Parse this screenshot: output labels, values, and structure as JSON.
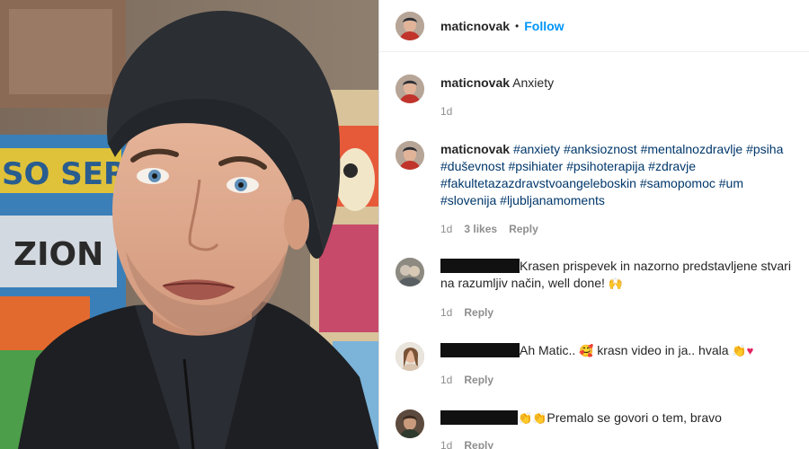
{
  "post": {
    "username": "maticnovak",
    "follow_label": "Follow",
    "separator": "•"
  },
  "caption": {
    "username": "maticnovak",
    "text": "Anxiety",
    "time": "1d"
  },
  "hashtags_comment": {
    "username": "maticnovak",
    "tags": [
      "#anxiety",
      "#anksioznost",
      "#mentalnozdravlje",
      "#psiha",
      "#duševnost",
      "#psihiater",
      "#psihoterapija",
      "#zdravje",
      "#fakultetazazdravstvoangeleboskin",
      "#samopomoc",
      "#um",
      "#slovenija",
      "#ljubljanamoments"
    ],
    "time": "1d",
    "likes": "3 likes",
    "reply": "Reply"
  },
  "comments": [
    {
      "text": "Krasen prispevek in nazorno predstavljene stvari na razumljiv način, well done! ",
      "emoji": "🙌",
      "time": "1d",
      "reply": "Reply"
    },
    {
      "text_before": "Ah Matic.. ",
      "emoji1": "🥰",
      "text_after": " krasn video in ja.. hvala ",
      "emoji2": "👏",
      "emoji3": "♥",
      "time": "1d",
      "reply": "Reply"
    },
    {
      "emoji": "👏👏",
      "text": "Premalo se govori o tem, bravo",
      "time": "1d",
      "reply": "Reply"
    }
  ],
  "video_graffiti": [
    "SO SER",
    "ZION"
  ],
  "icons": {
    "avatar": "avatar-icon"
  }
}
